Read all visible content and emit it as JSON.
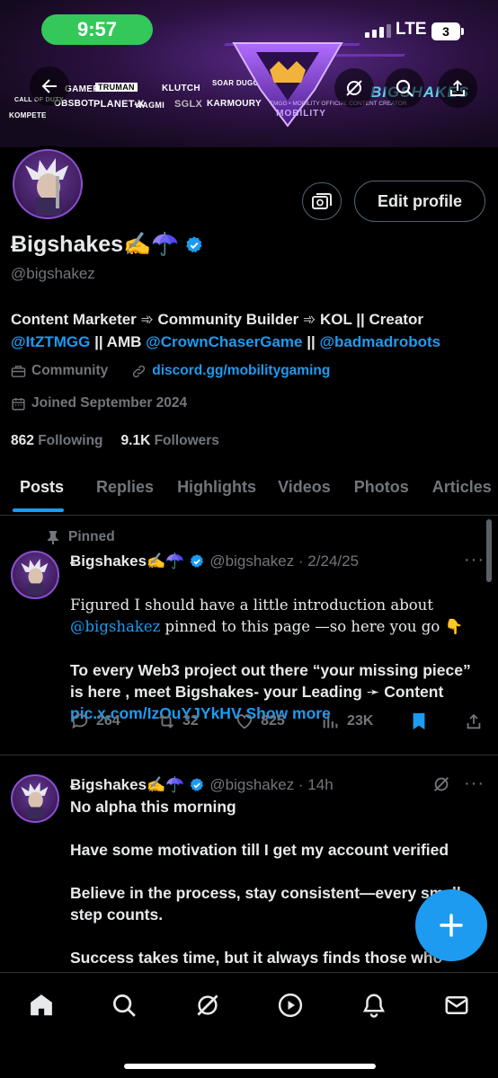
{
  "status_bar": {
    "time": "9:57",
    "network": "LTE",
    "battery": "3"
  },
  "banner": {
    "sponsors": [
      "GAMER",
      "CALL OF DUTY",
      "OBSBOT",
      "TRUMAN",
      "PLANET-X",
      "WAGMI",
      "KLUTCH",
      "SOAR DUGG",
      "SGLX",
      "KARMOURY",
      "KOMPETE"
    ],
    "emblem_text": "MOBILITY",
    "brand_logo": "BIGSHAKES",
    "tagline": "TMGG • MOBILITY OFFICIAL CONTENT CREATOR"
  },
  "profile": {
    "display_name": "Ƀigshakes✍️☂️",
    "handle": "@bigshakez",
    "edit_button": "Edit profile",
    "bio_text": "Content Marketer ➾ Community Builder ➾ KOL || Creator",
    "bio_mention_1": "@ItZTMGG",
    "bio_sep_1": " || AMB ",
    "bio_mention_2": "@CrownChaserGame",
    "bio_sep_2": " || ",
    "bio_mention_3": "@badmadrobots",
    "category": "Community",
    "website": "discord.gg/mobilitygaming",
    "joined": "Joined September 2024",
    "following_count": "862",
    "following_label": "Following",
    "followers_count": "9.1K",
    "followers_label": "Followers"
  },
  "tabs": [
    "Posts",
    "Replies",
    "Highlights",
    "Videos",
    "Photos",
    "Articles"
  ],
  "posts": [
    {
      "pinned_label": "Pinned",
      "name": "Ƀigshakes✍️☂️",
      "handle_date": "@bigshakez · 2/24/25",
      "text_1": "Figured I should have a little introduction about",
      "mention": "@bigshakez",
      "text_2": " pinned to this page —so here you go 👇",
      "text_3": "To every Web3 project out there “your missing piece” is here , meet Bigshakes- your Leading ➛ Content ",
      "link": "pic.x.com/IzOuYJYkHV",
      "show_more": "Show more",
      "replies": "264",
      "reposts": "32",
      "likes": "825",
      "views": "23K"
    },
    {
      "name": "Ƀigshakes✍️☂️",
      "handle_date": "@bigshakez · 14h",
      "text": "No alpha this morning\n\nHave some motivation till I get my account verified\n\nBelieve in the process, stay consistent—every small step counts.\n\nSuccess takes time, but it always finds those who"
    }
  ],
  "colors": {
    "accent": "#1d9bf0",
    "text": "#e7e9ea",
    "muted": "#71767b",
    "border": "#2f3336",
    "status_green": "#34c759"
  },
  "nav": [
    "home-icon",
    "search-icon",
    "grok-icon",
    "video-icon",
    "notifications-icon",
    "messages-icon"
  ]
}
